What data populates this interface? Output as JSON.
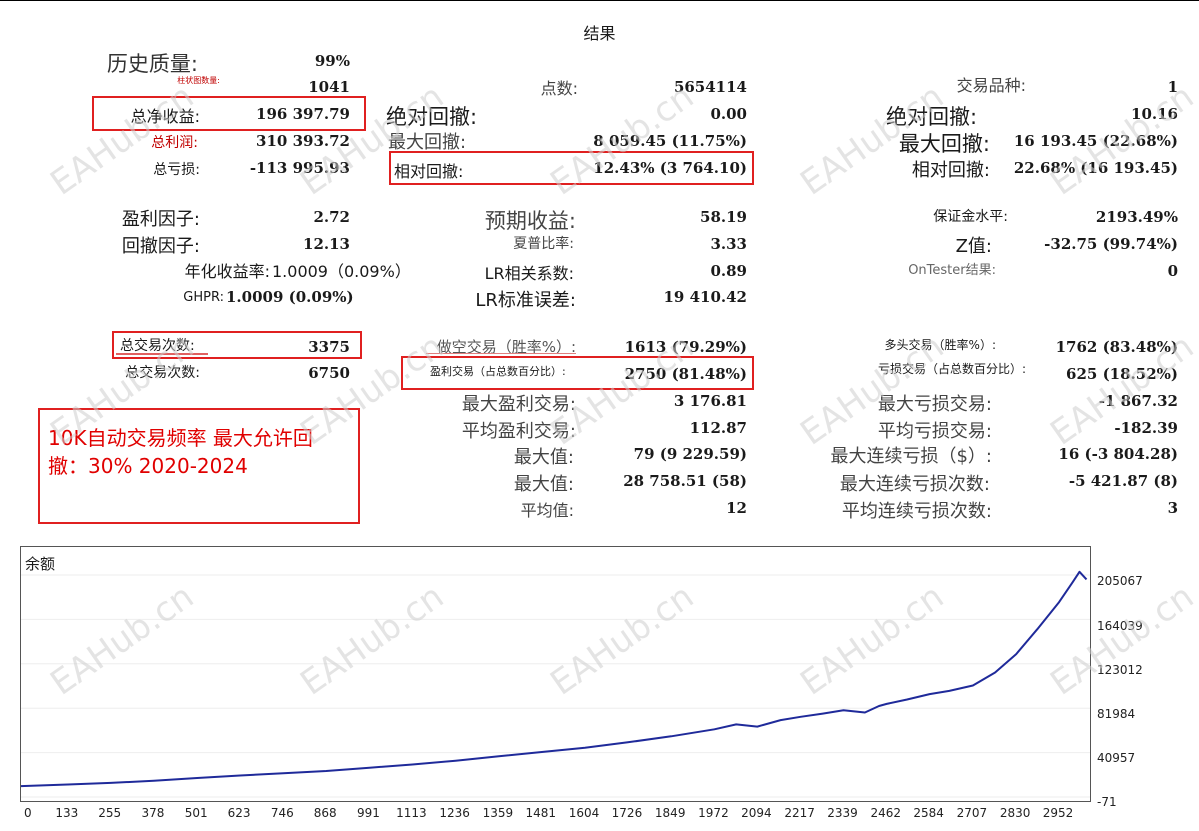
{
  "header": {
    "title": "结果"
  },
  "col1": {
    "history_quality": {
      "label": "历史质量:",
      "value": "99%"
    },
    "bars": {
      "label": "柱状图数量:",
      "value": "1041"
    },
    "net_profit": {
      "label": "总净收益:",
      "value": "196 397.79"
    },
    "gross_profit": {
      "label": "总利润:",
      "value": "310 393.72"
    },
    "gross_loss": {
      "label": "总亏损:",
      "value": "-113 995.93"
    },
    "profit_factor": {
      "label": "盈利因子:",
      "value": "2.72"
    },
    "recovery_factor": {
      "label": "回撤因子:",
      "value": "12.13"
    },
    "ahpr": {
      "label": "年化收益率:",
      "value": "1.0009（0.09%）"
    },
    "ghpr": {
      "label": "GHPR:",
      "value": "1.0009 (0.09%)"
    },
    "total_trades": {
      "label": "总交易次数:",
      "value": "3375"
    },
    "total_deals": {
      "label": "总交易次数:",
      "value": "6750"
    }
  },
  "col2": {
    "ticks": {
      "label": "点数:",
      "value": "5654114"
    },
    "abs_drawdown": {
      "label": "绝对回撤:",
      "value": "0.00"
    },
    "max_drawdown": {
      "label": "最大回撤:",
      "value": "8 059.45 (11.75%)"
    },
    "rel_drawdown": {
      "label": "相对回撤:",
      "value": "12.43% (3 764.10)"
    },
    "expected_payoff": {
      "label": "预期收益:",
      "value": "58.19"
    },
    "sharpe": {
      "label": "夏普比率:",
      "value": "3.33"
    },
    "lr_corr": {
      "label": "LR相关系数:",
      "value": "0.89"
    },
    "lr_err": {
      "label": "LR标准误差:",
      "value": "19 410.42"
    },
    "short_trades": {
      "label": "做空交易（胜率%）:",
      "value": "1613 (79.29%)"
    },
    "profit_trades": {
      "label": "盈利交易（占总数百分比）:",
      "value": "2750 (81.48%)"
    },
    "largest_profit": {
      "label": "最大盈利交易:",
      "value": "3 176.81"
    },
    "avg_profit": {
      "label": "平均盈利交易:",
      "value": "112.87"
    },
    "max_consec_wins": {
      "label": "最大值:",
      "value": "79 (9 229.59)"
    },
    "max_consec_profit": {
      "label": "最大值:",
      "value": "28 758.51 (58)"
    },
    "avg_consec_wins": {
      "label": "平均值:",
      "value": "12"
    }
  },
  "col3": {
    "symbols": {
      "label": "交易品种:",
      "value": "1"
    },
    "abs_drawdown": {
      "label": "绝对回撤:",
      "value": "10.16"
    },
    "max_drawdown": {
      "label": "最大回撤:",
      "value": "16 193.45 (22.68%)"
    },
    "rel_drawdown": {
      "label": "相对回撤:",
      "value": "22.68% (16 193.45)"
    },
    "margin_level": {
      "label": "保证金水平:",
      "value": "2193.49%"
    },
    "z_score": {
      "label": "Z值:",
      "value": "-32.75 (99.74%)"
    },
    "ontester": {
      "label": "OnTester结果:",
      "value": "0"
    },
    "long_trades": {
      "label": "多头交易（胜率%）:",
      "value": "1762 (83.48%)"
    },
    "loss_trades": {
      "label": "亏损交易（占总数百分比）:",
      "value": "625 (18.52%)"
    },
    "largest_loss": {
      "label": "最大亏损交易:",
      "value": "-1 867.32"
    },
    "avg_loss": {
      "label": "平均亏损交易:",
      "value": "-182.39"
    },
    "max_consec_losses": {
      "label": "最大连续亏损（$）:",
      "value": "16 (-3 804.28)"
    },
    "max_consec_loss_count": {
      "label": "最大连续亏损次数:",
      "value": "-5 421.87 (8)"
    },
    "avg_consec_losses": {
      "label": "平均连续亏损次数:",
      "value": "3"
    }
  },
  "note": {
    "text": "10K自动交易频率 最大允许回撤：30% 2020-2024"
  },
  "watermark": "EAHub.cn",
  "chart": {
    "label": "余额",
    "line_color": "#1f2a9a",
    "ylim": [
      -71,
      205067
    ],
    "yticks": [
      "205067",
      "164039",
      "123012",
      "81984",
      "40957",
      "-71"
    ],
    "xlim": [
      0,
      3040
    ],
    "xticks": [
      "0",
      "133",
      "255",
      "378",
      "501",
      "623",
      "746",
      "868",
      "991",
      "1113",
      "1236",
      "1359",
      "1481",
      "1604",
      "1726",
      "1849",
      "1972",
      "2094",
      "2217",
      "2339",
      "2462",
      "2584",
      "2707",
      "2830",
      "2952"
    ],
    "balance_points": [
      [
        0,
        10000
      ],
      [
        133,
        11500
      ],
      [
        255,
        13000
      ],
      [
        378,
        15000
      ],
      [
        501,
        17500
      ],
      [
        623,
        19800
      ],
      [
        746,
        21800
      ],
      [
        868,
        24000
      ],
      [
        991,
        27000
      ],
      [
        1113,
        30000
      ],
      [
        1236,
        33500
      ],
      [
        1359,
        37500
      ],
      [
        1481,
        41500
      ],
      [
        1604,
        45500
      ],
      [
        1726,
        50500
      ],
      [
        1849,
        56000
      ],
      [
        1972,
        62500
      ],
      [
        2034,
        67000
      ],
      [
        2094,
        65000
      ],
      [
        2160,
        71000
      ],
      [
        2217,
        74000
      ],
      [
        2280,
        77000
      ],
      [
        2339,
        80000
      ],
      [
        2400,
        78000
      ],
      [
        2440,
        84000
      ],
      [
        2462,
        86000
      ],
      [
        2520,
        90000
      ],
      [
        2584,
        95000
      ],
      [
        2640,
        98000
      ],
      [
        2707,
        103000
      ],
      [
        2770,
        115000
      ],
      [
        2830,
        132000
      ],
      [
        2890,
        155000
      ],
      [
        2952,
        180000
      ],
      [
        2990,
        198000
      ],
      [
        3010,
        208000
      ],
      [
        3030,
        201000
      ]
    ]
  }
}
